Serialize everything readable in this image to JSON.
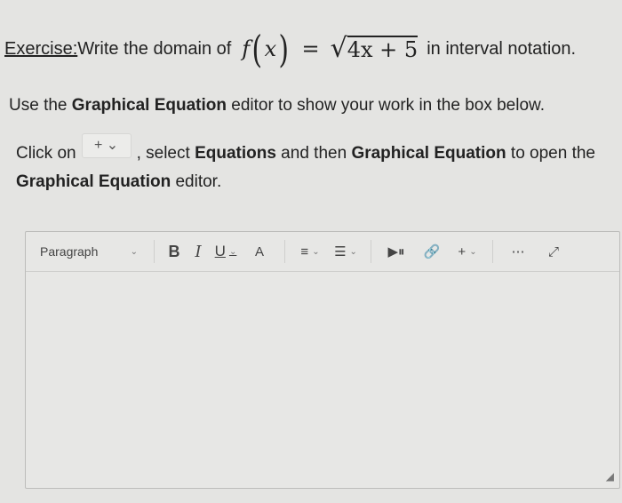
{
  "exercise": {
    "label": "Exercise:",
    "text_before": " Write the domain of ",
    "math_f": "f",
    "math_var": "x",
    "math_eq": "=",
    "math_radicand": "4x + 5",
    "text_after": "in interval notation."
  },
  "instructions": {
    "use_prefix": "Use the ",
    "use_bold": "Graphical Equation",
    "use_suffix": " editor to show your work in the box below.",
    "click_prefix": "Click on",
    "plus_button": "+ ⌄",
    "click_mid1": ", select ",
    "click_bold1": "Equations",
    "click_mid2": " and then ",
    "click_bold2": "Graphical Equation",
    "click_mid3": " to open the ",
    "click_bold3": "Graphical Equation",
    "click_suffix": " editor."
  },
  "toolbar": {
    "paragraph": "Paragraph",
    "bold": "B",
    "italic": "I",
    "underline": "U",
    "text_color": "A",
    "align": "≡",
    "list": "☰",
    "media": "▶⏸",
    "link": "🔗",
    "insert": "+",
    "more": "⋯",
    "fullscreen": "⤢"
  },
  "icons": {
    "chevron": "chevron-down-icon",
    "resize": "resize-handle-icon"
  }
}
